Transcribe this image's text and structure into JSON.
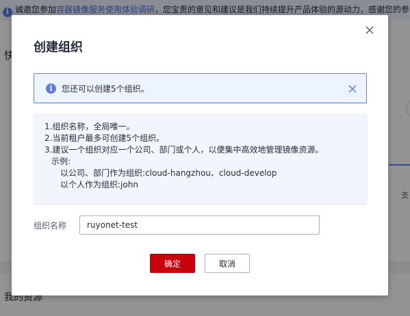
{
  "background": {
    "banner": {
      "prefix": "诚邀您参加",
      "link": "容器镜像服务使用体验调研",
      "suffix": "，您宝贵的意见和建议是我们持续提升产品体验的源动力，感谢您的参"
    },
    "side_text": "快",
    "right_text": "支",
    "bottom_text": "我的资源"
  },
  "modal": {
    "title": "创建组织",
    "alert": {
      "text": "您还可以创建5个组织。"
    },
    "tips": {
      "line1": "1.组织名称，全局唯一。",
      "line2": "2.当前租户最多可创建5个组织。",
      "line3": "3.建议一个组织对应一个公司、部门或个人，以便集中高效地管理镜像资源。",
      "example_label": "示例:",
      "example1": "以公司、部门作为组织:cloud-hangzhou、cloud-develop",
      "example2": "以个人作为组织:john"
    },
    "form": {
      "label": "组织名称",
      "value": "ruyonet-test"
    },
    "buttons": {
      "ok": "确定",
      "cancel": "取消"
    }
  },
  "colors": {
    "primary": "#c7000b",
    "accent": "#5e7ce0",
    "alert_bg": "#edf3ff",
    "tips_bg": "#f2f5fc"
  }
}
